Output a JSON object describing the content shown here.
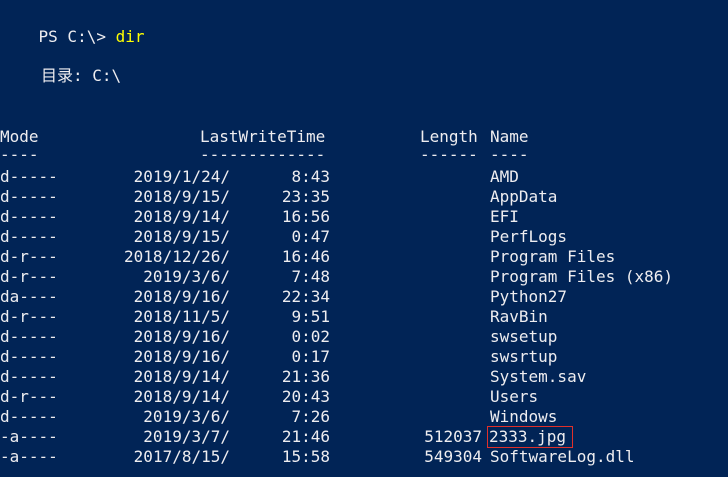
{
  "prompt": {
    "prefix": "PS C:\\> ",
    "command": "dir"
  },
  "directory": {
    "label": "目录: C:\\"
  },
  "headers": {
    "mode": "Mode",
    "last_write_time": "LastWriteTime",
    "length": "Length",
    "name": "Name"
  },
  "underlines": {
    "mode": "----",
    "last_write_time": "-------------",
    "length": "------",
    "name": "----"
  },
  "entries": [
    {
      "mode": "d-----",
      "date": "2019/1/24/",
      "time": "8:43",
      "length": "",
      "name": "AMD"
    },
    {
      "mode": "d-----",
      "date": "2018/9/15/",
      "time": "23:35",
      "length": "",
      "name": "AppData"
    },
    {
      "mode": "d-----",
      "date": "2018/9/14/",
      "time": "16:56",
      "length": "",
      "name": "EFI"
    },
    {
      "mode": "d-----",
      "date": "2018/9/15/",
      "time": "0:47",
      "length": "",
      "name": "PerfLogs"
    },
    {
      "mode": "d-r---",
      "date": "2018/12/26/",
      "time": "16:46",
      "length": "",
      "name": "Program Files"
    },
    {
      "mode": "d-r---",
      "date": "2019/3/6/",
      "time": "7:48",
      "length": "",
      "name": "Program Files (x86)"
    },
    {
      "mode": "da----",
      "date": "2018/9/16/",
      "time": "22:34",
      "length": "",
      "name": "Python27"
    },
    {
      "mode": "d-r---",
      "date": "2018/11/5/",
      "time": "9:51",
      "length": "",
      "name": "RavBin"
    },
    {
      "mode": "d-----",
      "date": "2018/9/16/",
      "time": "0:02",
      "length": "",
      "name": "swsetup"
    },
    {
      "mode": "d-----",
      "date": "2018/9/16/",
      "time": "0:17",
      "length": "",
      "name": "swsrtup"
    },
    {
      "mode": "d-----",
      "date": "2018/9/14/",
      "time": "21:36",
      "length": "",
      "name": "System.sav"
    },
    {
      "mode": "d-r---",
      "date": "2018/9/14/",
      "time": "20:43",
      "length": "",
      "name": "Users"
    },
    {
      "mode": "d-----",
      "date": "2019/3/6/",
      "time": "7:26",
      "length": "",
      "name": "Windows"
    },
    {
      "mode": "-a----",
      "date": "2019/3/7/",
      "time": "21:46",
      "length": "512037",
      "name": "2333.jpg",
      "highlighted": true
    },
    {
      "mode": "-a----",
      "date": "2017/8/15/",
      "time": "15:58",
      "length": "549304",
      "name": "SoftwareLog.dll"
    }
  ],
  "colors": {
    "background": "#012456",
    "foreground": "#eeedf0",
    "command": "#ffff00",
    "highlight_box": "#e0302a"
  }
}
